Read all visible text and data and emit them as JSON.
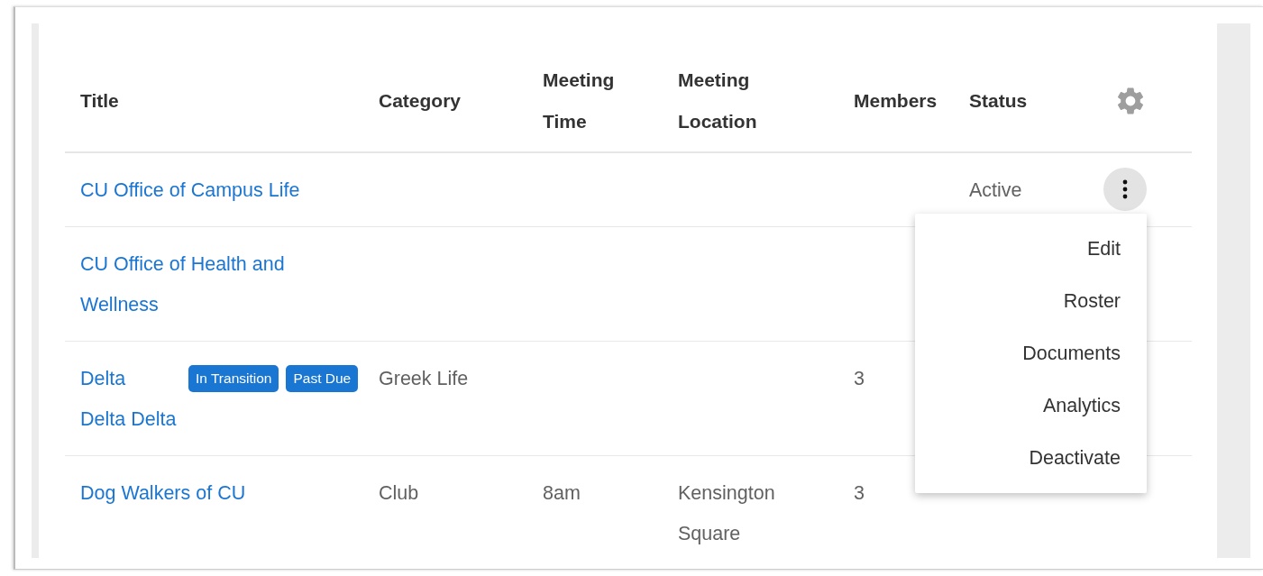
{
  "table": {
    "columns": [
      "Title",
      "Category",
      "Meeting Time",
      "Meeting Location",
      "Members",
      "Status"
    ],
    "rows": [
      {
        "title": "CU Office of Campus Life",
        "tags": [],
        "category": "",
        "meeting_time": "",
        "meeting_location": "",
        "members": "",
        "status": "Active",
        "menu_open": true
      },
      {
        "title": "CU Office of Health and Wellness",
        "tags": [],
        "category": "",
        "meeting_time": "",
        "meeting_location": "",
        "members": "",
        "status": ""
      },
      {
        "title": "Delta Delta Delta",
        "tags": [
          "In Transition",
          "Past Due"
        ],
        "category": "Greek Life",
        "meeting_time": "",
        "meeting_location": "",
        "members": "3",
        "status": ""
      },
      {
        "title": "Dog Walkers of CU",
        "tags": [],
        "category": "Club",
        "meeting_time": "8am",
        "meeting_location": "Kensington Square",
        "members": "3",
        "status": ""
      }
    ]
  },
  "row_menu": {
    "items": [
      "Edit",
      "Roster",
      "Documents",
      "Analytics",
      "Deactivate"
    ]
  }
}
